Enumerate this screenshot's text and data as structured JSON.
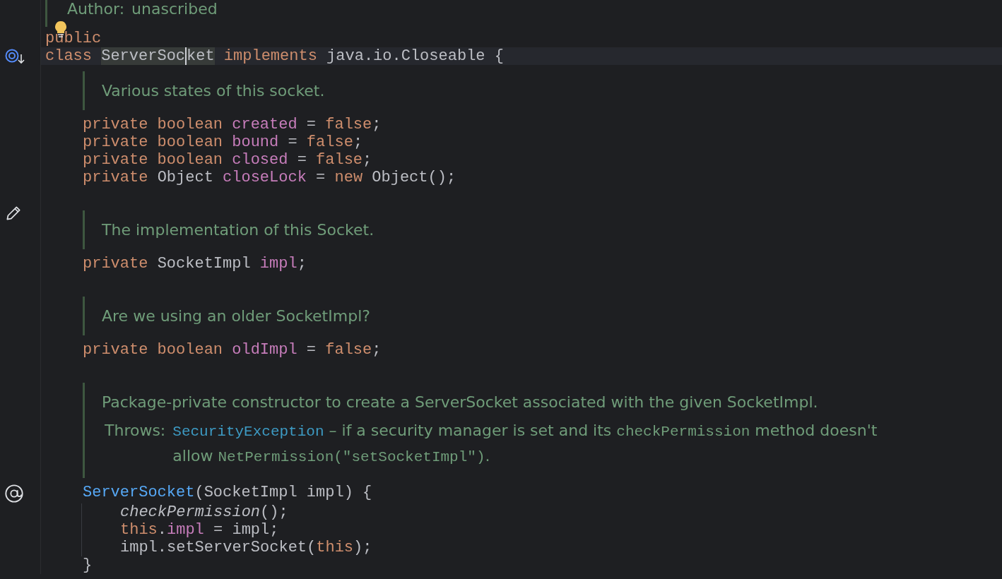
{
  "editor": {
    "items": [
      {
        "kind": "doc",
        "tags": [
          {
            "label": "Author:",
            "parts": [
              {
                "kind": "text",
                "text": "unascribed"
              }
            ]
          }
        ]
      },
      {
        "kind": "code",
        "bulb": true,
        "tokens": [
          {
            "kind": "keyword",
            "text": "public"
          }
        ]
      },
      {
        "kind": "code",
        "current": true,
        "gutter": {
          "kind": "implemented"
        },
        "tokens": [
          {
            "kind": "keyword",
            "text": "class "
          },
          {
            "kind": "usage",
            "text": "ServerSoc",
            "caret": true
          },
          {
            "kind": "usage",
            "text": "ket"
          },
          {
            "kind": "keyword",
            "text": " implements "
          },
          {
            "kind": "plain",
            "text": "java.io.Closeable {"
          }
        ],
        "body": [
          {
            "kind": "doc",
            "text": "Various states of this socket."
          },
          {
            "kind": "code",
            "tokens": [
              {
                "kind": "keyword",
                "text": "private boolean "
              },
              {
                "kind": "field",
                "text": "created"
              },
              {
                "kind": "plain",
                "text": " = "
              },
              {
                "kind": "keyword",
                "text": "false"
              },
              {
                "kind": "plain",
                "text": ";"
              }
            ]
          },
          {
            "kind": "code",
            "tokens": [
              {
                "kind": "keyword",
                "text": "private boolean "
              },
              {
                "kind": "field",
                "text": "bound"
              },
              {
                "kind": "plain",
                "text": " = "
              },
              {
                "kind": "keyword",
                "text": "false"
              },
              {
                "kind": "plain",
                "text": ";"
              }
            ]
          },
          {
            "kind": "code",
            "tokens": [
              {
                "kind": "keyword",
                "text": "private boolean "
              },
              {
                "kind": "field",
                "text": "closed"
              },
              {
                "kind": "plain",
                "text": " = "
              },
              {
                "kind": "keyword",
                "text": "false"
              },
              {
                "kind": "plain",
                "text": ";"
              }
            ]
          },
          {
            "kind": "code",
            "tokens": [
              {
                "kind": "keyword",
                "text": "private "
              },
              {
                "kind": "plain",
                "text": "Object "
              },
              {
                "kind": "field",
                "text": "closeLock"
              },
              {
                "kind": "plain",
                "text": " = "
              },
              {
                "kind": "keyword",
                "text": "new "
              },
              {
                "kind": "plain",
                "text": "Object();"
              }
            ]
          },
          {
            "kind": "blank"
          },
          {
            "kind": "doc",
            "gutter": {
              "kind": "edit"
            },
            "text": "The implementation of this Socket."
          },
          {
            "kind": "code",
            "tokens": [
              {
                "kind": "keyword",
                "text": "private "
              },
              {
                "kind": "plain",
                "text": "SocketImpl "
              },
              {
                "kind": "field",
                "text": "impl"
              },
              {
                "kind": "plain",
                "text": ";"
              }
            ]
          },
          {
            "kind": "blank"
          },
          {
            "kind": "doc",
            "text": "Are we using an older SocketImpl?"
          },
          {
            "kind": "code",
            "tokens": [
              {
                "kind": "keyword",
                "text": "private boolean "
              },
              {
                "kind": "field",
                "text": "oldImpl"
              },
              {
                "kind": "plain",
                "text": " = "
              },
              {
                "kind": "keyword",
                "text": "false"
              },
              {
                "kind": "plain",
                "text": ";"
              }
            ]
          },
          {
            "kind": "blank"
          },
          {
            "kind": "doc",
            "text": "Package-private constructor to create a ServerSocket associated with the given SocketImpl.",
            "tags": [
              {
                "label": "Throws:",
                "parts": [
                  {
                    "kind": "link",
                    "text": "SecurityException"
                  },
                  {
                    "kind": "text",
                    "text": " – if a security manager is set and its "
                  },
                  {
                    "kind": "code",
                    "text": "checkPermission"
                  },
                  {
                    "kind": "text",
                    "text": " method doesn't allow "
                  },
                  {
                    "kind": "code",
                    "text": "NetPermission(\"setSocketImpl\")"
                  },
                  {
                    "kind": "text",
                    "text": "."
                  }
                ]
              }
            ]
          },
          {
            "kind": "code",
            "gutter": {
              "kind": "annotation"
            },
            "tokens": [
              {
                "kind": "method_decl",
                "text": "ServerSocket"
              },
              {
                "kind": "plain",
                "text": "(SocketImpl impl) {"
              }
            ],
            "closing": "}",
            "body": [
              {
                "kind": "code",
                "tokens": [
                  {
                    "kind": "static_call",
                    "text": "checkPermission"
                  },
                  {
                    "kind": "plain",
                    "text": "();"
                  }
                ]
              },
              {
                "kind": "code",
                "tokens": [
                  {
                    "kind": "keyword",
                    "text": "this"
                  },
                  {
                    "kind": "plain",
                    "text": "."
                  },
                  {
                    "kind": "field",
                    "text": "impl"
                  },
                  {
                    "kind": "plain",
                    "text": " = impl;"
                  }
                ]
              },
              {
                "kind": "code",
                "tokens": [
                  {
                    "kind": "plain",
                    "text": "impl.setServerSocket("
                  },
                  {
                    "kind": "keyword",
                    "text": "this"
                  },
                  {
                    "kind": "plain",
                    "text": ");"
                  }
                ]
              }
            ]
          }
        ]
      }
    ]
  }
}
